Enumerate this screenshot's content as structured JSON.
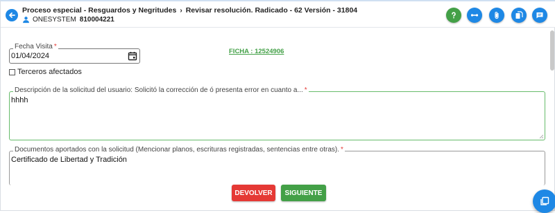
{
  "header": {
    "breadcrumb": {
      "process": "Proceso especial - Resguardos y Negritudes",
      "step": "Revisar resolución. Radicado - 62 Versión - 31804"
    },
    "system_name": "ONESYSTEM",
    "system_id": "810004221",
    "toolbar_icons": [
      "help-icon",
      "link-icon",
      "attachment-icon",
      "documents-icon",
      "chat-icon"
    ],
    "colors": {
      "primary": "#1e88e5",
      "success": "#43a047",
      "danger": "#e53935"
    }
  },
  "form": {
    "fecha_visita": {
      "label": "Fecha Visita",
      "required_mark": "*",
      "value": "01/04/2024"
    },
    "ficha_link": "FICHA : 12524906",
    "terceros_checkbox": {
      "label": "Terceros afectados",
      "checked": false
    },
    "descripcion": {
      "label": "Descripción de la solicitud del usuario: Solicitó la corrección de ó presenta error en cuanto a...",
      "required_mark": "*",
      "value": "hhhh"
    },
    "documentos": {
      "label": "Documentos aportados con la solicitud (Mencionar planos, escrituras registradas, sentencias entre otras).",
      "required_mark": "*",
      "value": "Certificado de Libertad y Tradición"
    }
  },
  "actions": {
    "devolver_label": "DEVOLVER",
    "siguiente_label": "SIGUIENTE"
  }
}
